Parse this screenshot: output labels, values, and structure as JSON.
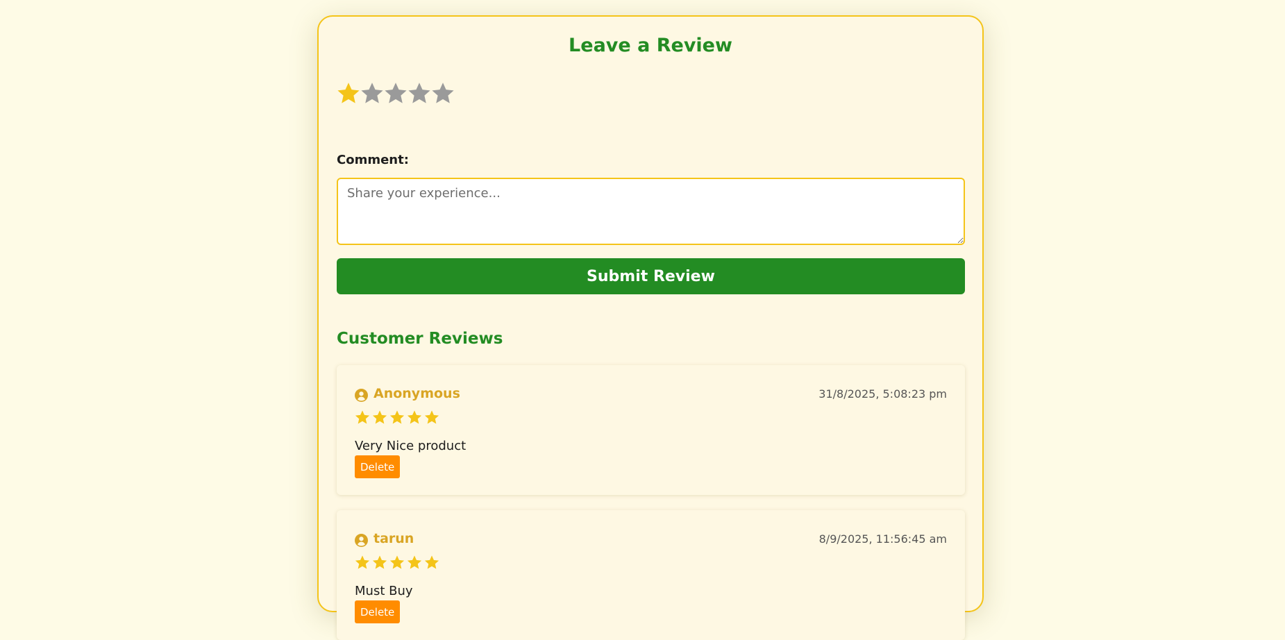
{
  "form": {
    "title": "Leave a Review",
    "rating": 1,
    "rating_max": 5,
    "comment_label": "Comment:",
    "comment_placeholder": "Share your experience...",
    "comment_value": "",
    "submit_label": "Submit Review"
  },
  "reviews_section": {
    "heading": "Customer Reviews",
    "items": [
      {
        "author": "Anonymous",
        "date": "31/8/2025, 5:08:23 pm",
        "rating": 5,
        "text": "Very Nice product",
        "delete_label": "Delete"
      },
      {
        "author": "tarun",
        "date": "8/9/2025, 11:56:45 am",
        "rating": 5,
        "text": "Must Buy",
        "delete_label": "Delete"
      }
    ]
  },
  "colors": {
    "page_background": "#fefbe6",
    "card_background": "#fef8e3",
    "card_border": "#f4c419",
    "accent_green": "#238c23",
    "star_active": "#f4c419",
    "star_inactive": "#9a9a9a",
    "author_gold": "#d9a524",
    "delete_orange": "#ff8c00"
  },
  "icons": {
    "rating_star": "star-icon",
    "review_user": "user-circle-icon"
  }
}
